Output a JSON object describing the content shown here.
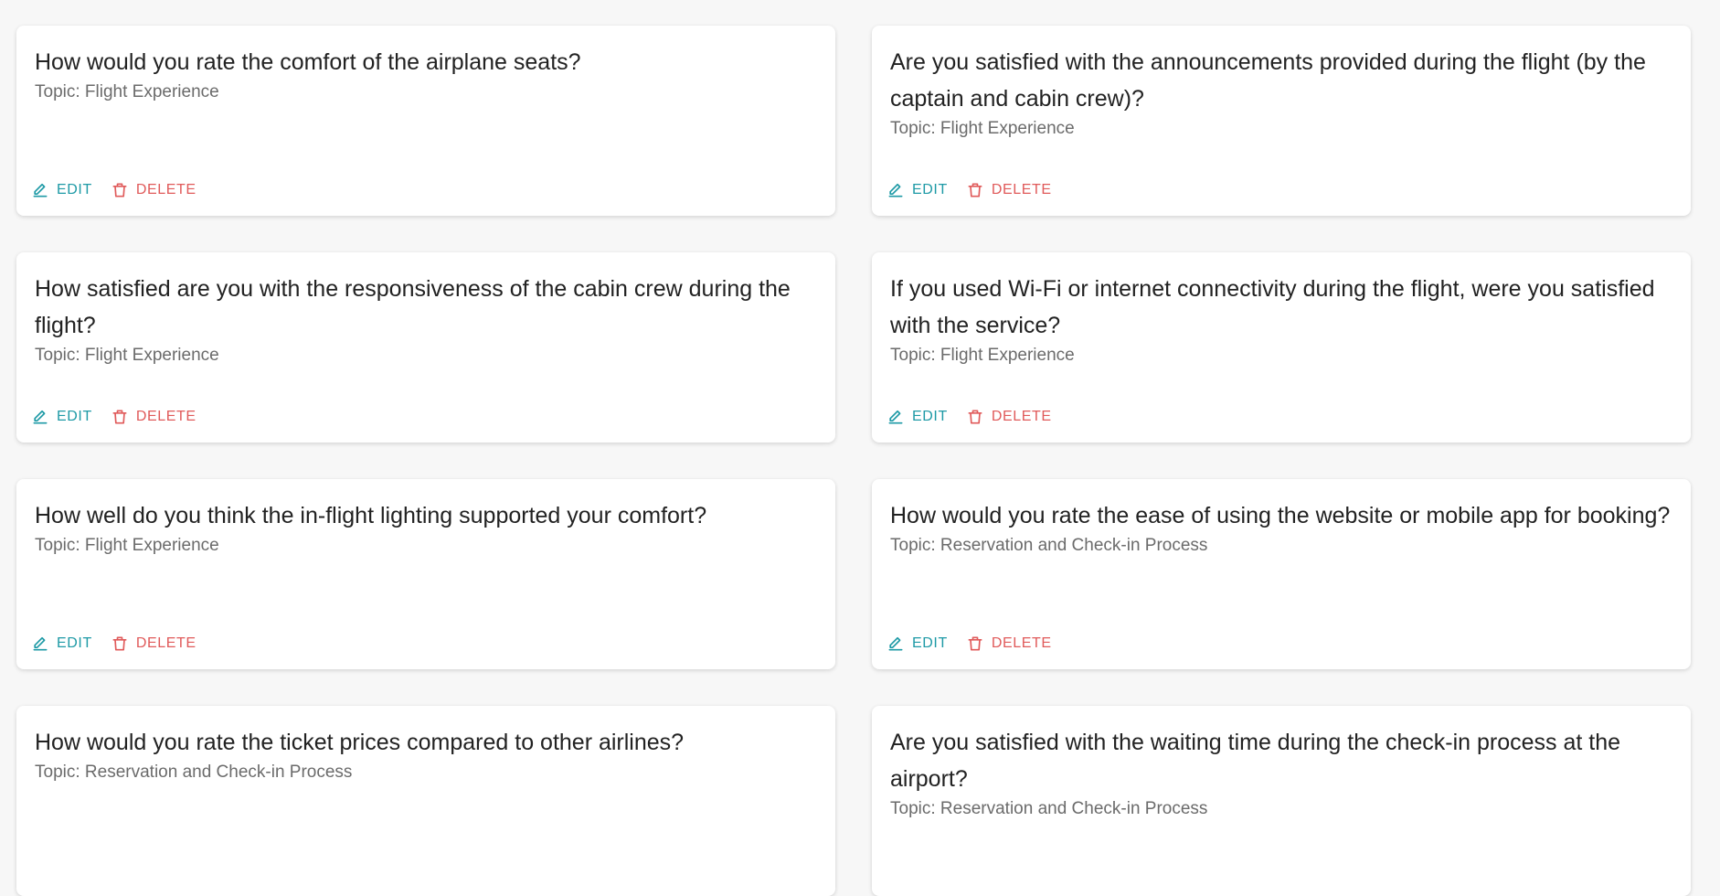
{
  "actions": {
    "edit_label": "EDIT",
    "delete_label": "DELETE"
  },
  "colors": {
    "edit": "#1e9aa6",
    "delete": "#e05a5a",
    "background": "#f7f7f7"
  },
  "icons": {
    "edit": "pencil-icon",
    "delete": "trash-icon"
  },
  "cards": [
    {
      "question": "How would you rate the comfort of the airplane seats?",
      "topic": "Topic: Flight Experience"
    },
    {
      "question": "Are you satisfied with the announcements provided during the flight (by the captain and cabin crew)?",
      "topic": "Topic: Flight Experience"
    },
    {
      "question": "How satisfied are you with the responsiveness of the cabin crew during the flight?",
      "topic": "Topic: Flight Experience"
    },
    {
      "question": "If you used Wi-Fi or internet connectivity during the flight, were you satisfied with the service?",
      "topic": "Topic: Flight Experience"
    },
    {
      "question": "How well do you think the in-flight lighting supported your comfort?",
      "topic": "Topic: Flight Experience"
    },
    {
      "question": "How would you rate the ease of using the website or mobile app for booking?",
      "topic": "Topic: Reservation and Check-in Process"
    },
    {
      "question": "How would you rate the ticket prices compared to other airlines?",
      "topic": "Topic: Reservation and Check-in Process"
    },
    {
      "question": "Are you satisfied with the waiting time during the check-in process at the airport?",
      "topic": "Topic: Reservation and Check-in Process"
    }
  ]
}
